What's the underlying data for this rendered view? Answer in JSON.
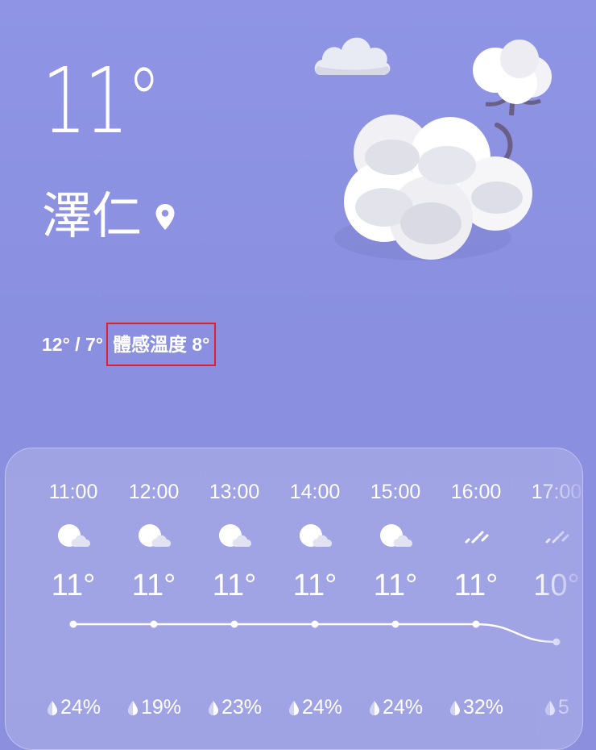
{
  "current": {
    "temperature": "11°",
    "city": "澤仁",
    "range": "12° / 7°",
    "feels_like": "體感溫度 8°"
  },
  "icons": {
    "location": "location-pin-icon",
    "weather_art": "cotton-cloud-illustration",
    "small_cloud": "cloud-icon",
    "hourly_cloudy": "partly-cloudy-icon",
    "hourly_drizzle": "drizzle-icon",
    "precip": "raindrop-icon"
  },
  "colors": {
    "background": "#8f95e4",
    "text": "#ffffff",
    "highlight_box": "#e02030"
  },
  "hourly": [
    {
      "time": "11:00",
      "icon": "partly-cloudy-icon",
      "temp": "11°",
      "temp_value": 11,
      "precip": "24%"
    },
    {
      "time": "12:00",
      "icon": "partly-cloudy-icon",
      "temp": "11°",
      "temp_value": 11,
      "precip": "19%"
    },
    {
      "time": "13:00",
      "icon": "partly-cloudy-icon",
      "temp": "11°",
      "temp_value": 11,
      "precip": "23%"
    },
    {
      "time": "14:00",
      "icon": "partly-cloudy-icon",
      "temp": "11°",
      "temp_value": 11,
      "precip": "24%"
    },
    {
      "time": "15:00",
      "icon": "partly-cloudy-icon",
      "temp": "11°",
      "temp_value": 11,
      "precip": "24%"
    },
    {
      "time": "16:00",
      "icon": "drizzle-icon",
      "temp": "11°",
      "temp_value": 11,
      "precip": "32%"
    },
    {
      "time": "17:00",
      "icon": "drizzle-icon",
      "temp": "10°",
      "temp_value": 10,
      "precip": "5"
    }
  ]
}
